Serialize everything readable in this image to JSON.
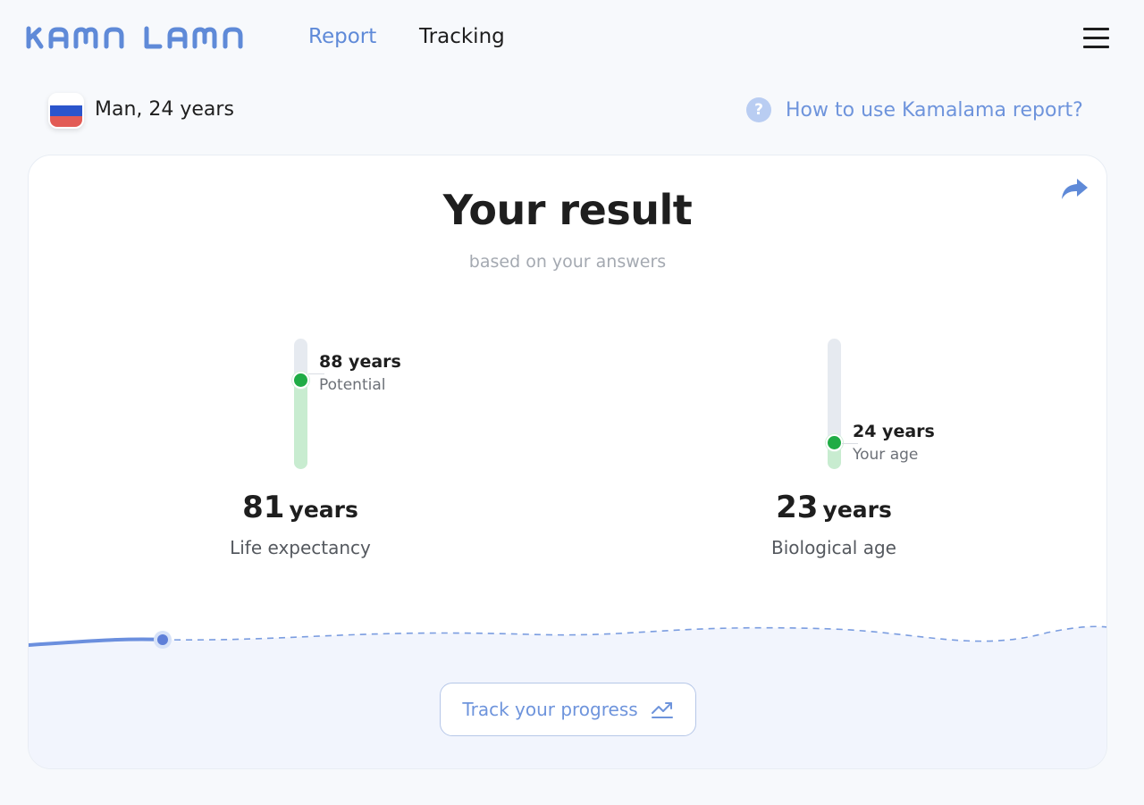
{
  "header": {
    "logo_text": "KAMA LAMA",
    "nav": {
      "report": "Report",
      "tracking": "Tracking"
    }
  },
  "profile": {
    "flag": "russia-flag",
    "summary": "Man, 24 years"
  },
  "help": {
    "icon": "question-icon",
    "text": "How to use Kamalama report?"
  },
  "result_card": {
    "title": "Your result",
    "subtitle": "based on your answers",
    "life_expectancy": {
      "value": "81",
      "unit": "years",
      "label": "Life expectancy",
      "marker_value": "88 years",
      "marker_label": "Potential",
      "level": 0.68
    },
    "biological_age": {
      "value": "23",
      "unit": "years",
      "label": "Biological age",
      "marker_value": "24 years",
      "marker_label": "Your age",
      "level": 0.2
    },
    "track_button": "Track your progress"
  },
  "colors": {
    "accent": "#5f8ad8",
    "green": "#1fac45",
    "green_light": "#c8ecd0",
    "wave_fill": "#f2f5fd"
  }
}
